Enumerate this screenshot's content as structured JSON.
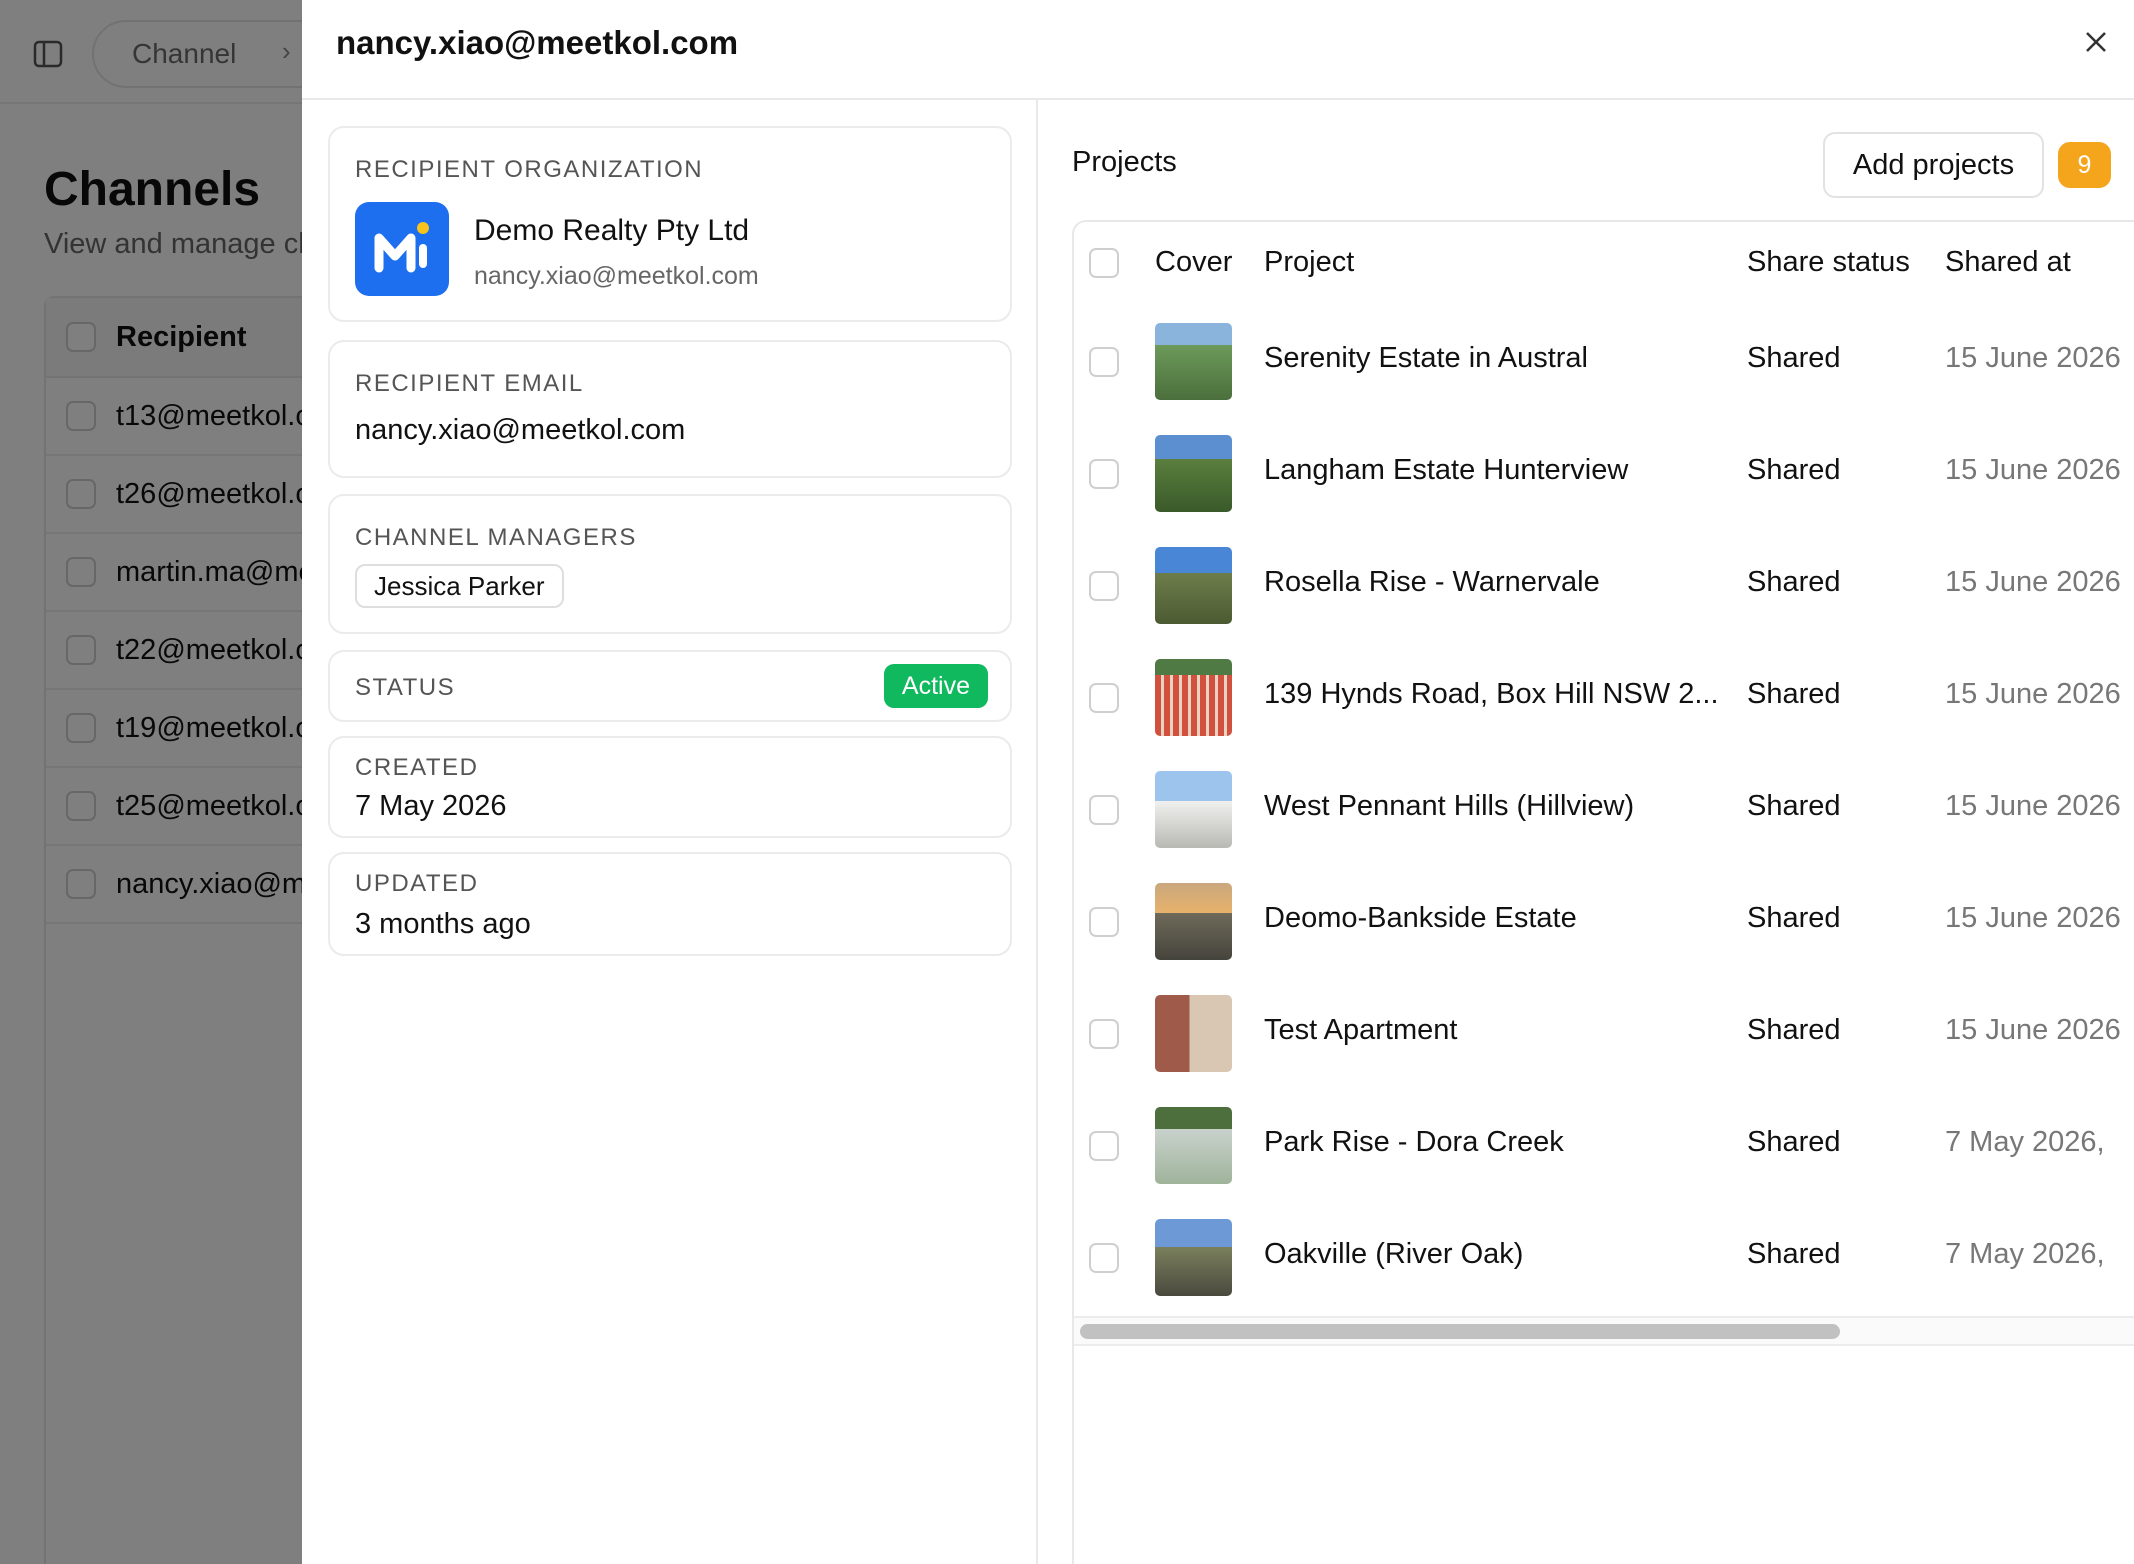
{
  "background": {
    "breadcrumb": "Channel",
    "page_title": "Channels",
    "page_subtitle": "View and manage ch",
    "table_header": "Recipient",
    "rows": [
      "t13@meetkol.c",
      "t26@meetkol.c",
      "martin.ma@me",
      "t22@meetkol.c",
      "t19@meetkol.c",
      "t25@meetkol.c",
      "nancy.xiao@me"
    ]
  },
  "drawer": {
    "title": "nancy.xiao@meetkol.com",
    "close_icon": "close-icon",
    "recipient_org": {
      "caption": "RECIPIENT ORGANIZATION",
      "name": "Demo Realty Pty Ltd",
      "email": "nancy.xiao@meetkol.com",
      "logo_color": "#1e6ff0"
    },
    "recipient_email": {
      "caption": "RECIPIENT EMAIL",
      "value": "nancy.xiao@meetkol.com"
    },
    "channel_managers": {
      "caption": "CHANNEL MANAGERS",
      "managers": [
        "Jessica Parker"
      ]
    },
    "status": {
      "caption": "STATUS",
      "value": "Active",
      "color": "#10b85e"
    },
    "created": {
      "caption": "CREATED",
      "value": "7 May 2026"
    },
    "updated": {
      "caption": "UPDATED",
      "value": "3 months ago"
    },
    "projects": {
      "title": "Projects",
      "add_button": "Add projects",
      "count": "9",
      "count_color": "#f5a51c",
      "columns": [
        "Cover",
        "Project",
        "Share status",
        "Shared at"
      ],
      "rows": [
        {
          "project": "Serenity Estate in Austral",
          "status": "Shared",
          "shared_at": "15 June 2026"
        },
        {
          "project": "Langham Estate Hunterview",
          "status": "Shared",
          "shared_at": "15 June 2026"
        },
        {
          "project": "Rosella Rise - Warnervale",
          "status": "Shared",
          "shared_at": "15 June 2026"
        },
        {
          "project": "139 Hynds Road, Box Hill NSW 2...",
          "status": "Shared",
          "shared_at": "15 June 2026"
        },
        {
          "project": "West Pennant Hills (Hillview)",
          "status": "Shared",
          "shared_at": "15 June 2026"
        },
        {
          "project": "Deomo-Bankside Estate",
          "status": "Shared",
          "shared_at": "15 June 2026"
        },
        {
          "project": "Test Apartment",
          "status": "Shared",
          "shared_at": "15 June 2026"
        },
        {
          "project": "Park Rise - Dora Creek",
          "status": "Shared",
          "shared_at": "7 May 2026,"
        },
        {
          "project": "Oakville (River Oak)",
          "status": "Shared",
          "shared_at": "7 May 2026,"
        }
      ]
    }
  }
}
